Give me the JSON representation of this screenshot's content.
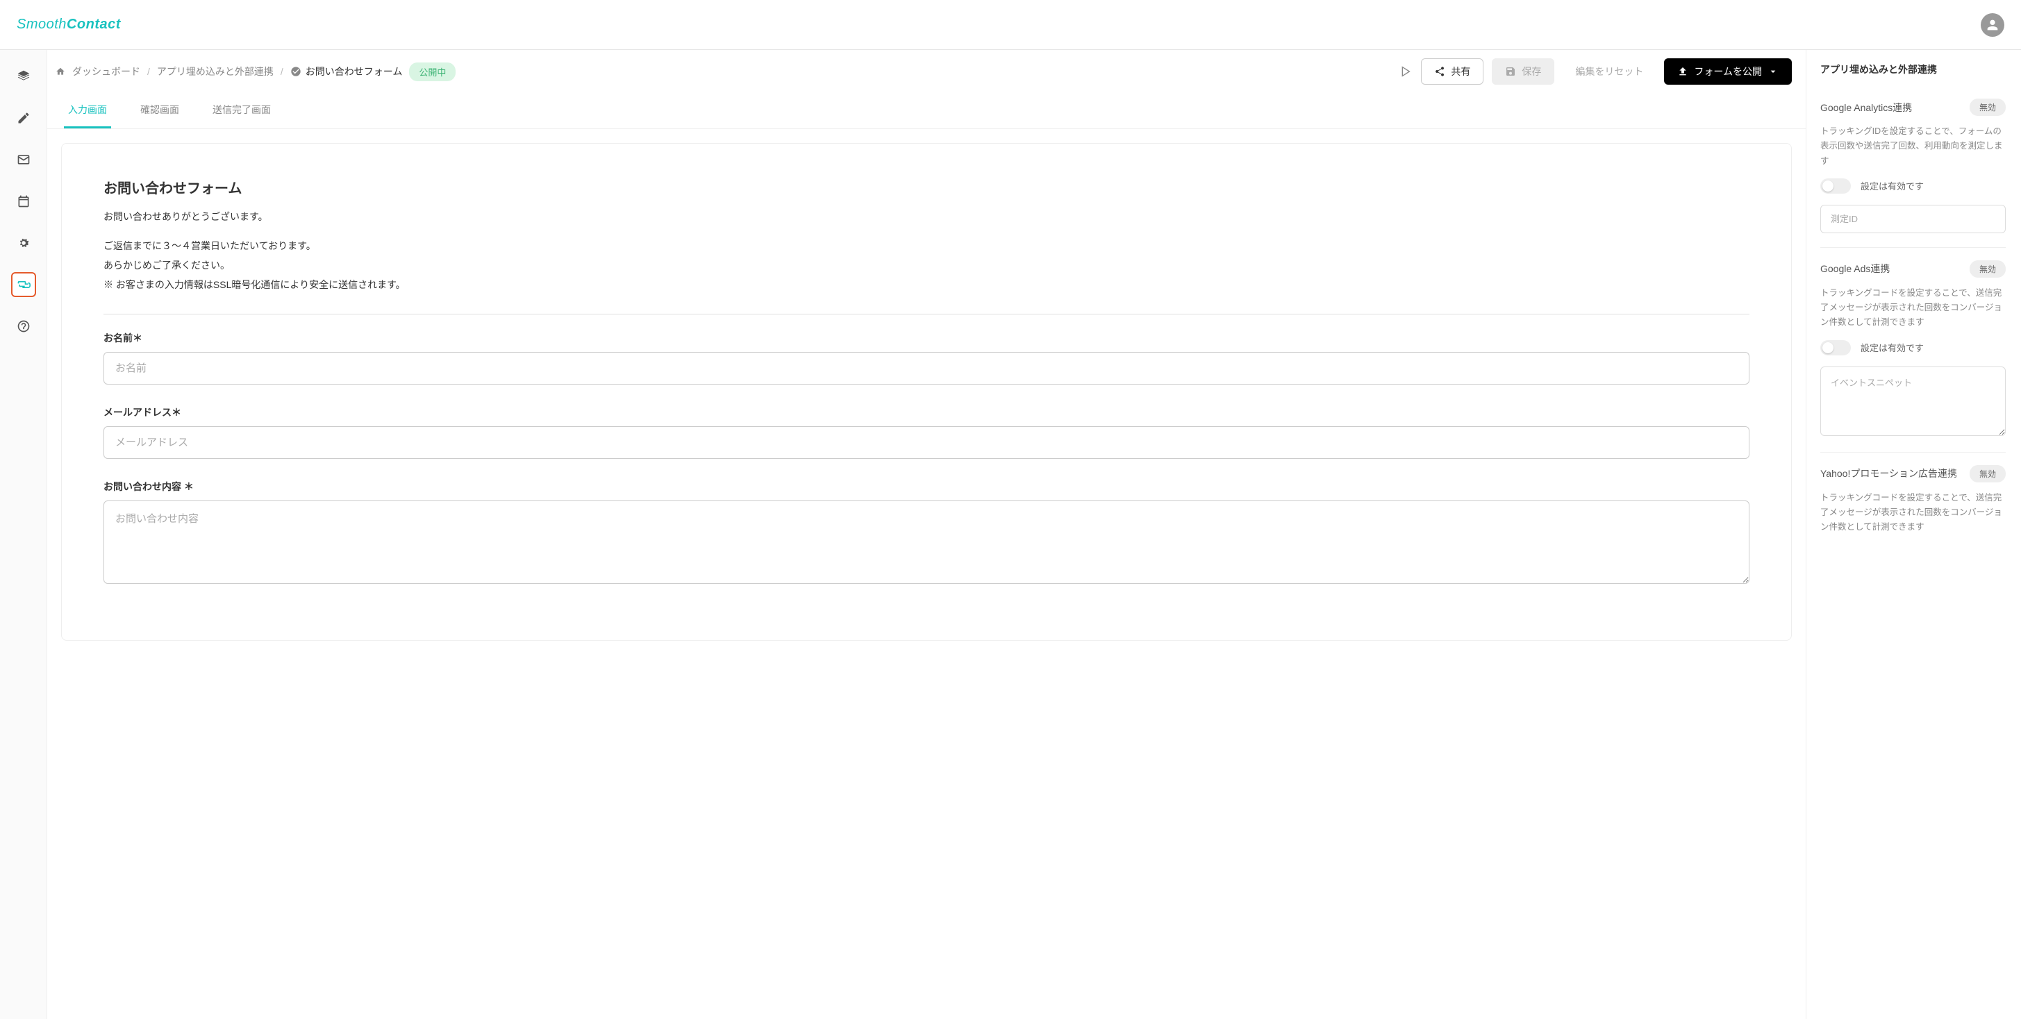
{
  "logo": {
    "part1": "Smooth",
    "part2": "Contact"
  },
  "breadcrumbs": {
    "dashboard": "ダッシュボード",
    "embed": "アプリ埋め込みと外部連携",
    "form": "お問い合わせフォーム"
  },
  "status": "公開中",
  "toolbar": {
    "share": "共有",
    "save": "保存",
    "reset": "編集をリセット",
    "publish": "フォームを公開"
  },
  "tabs": {
    "input": "入力画面",
    "confirm": "確認画面",
    "done": "送信完了画面"
  },
  "form": {
    "title": "お問い合わせフォーム",
    "desc1": "お問い合わせありがとうございます。",
    "desc2": "ご返信までに３〜４営業日いただいております。",
    "desc3": "あらかじめご了承ください。",
    "desc4": "※ お客さまの入力情報はSSL暗号化通信により安全に送信されます。",
    "name_label": "お名前＊",
    "name_placeholder": "お名前",
    "email_label": "メールアドレス＊",
    "email_placeholder": "メールアドレス",
    "inquiry_label": "お問い合わせ内容 ＊",
    "inquiry_placeholder": "お問い合わせ内容"
  },
  "rightPanel": {
    "title": "アプリ埋め込みと外部連携",
    "sections": [
      {
        "title": "Google Analytics連携",
        "badge": "無効",
        "desc": "トラッキングIDを設定することで、フォームの表示回数や送信完了回数、利用動向を測定します",
        "toggleLabel": "設定は有効です",
        "inputPlaceholder": "測定ID"
      },
      {
        "title": "Google Ads連携",
        "badge": "無効",
        "desc": "トラッキングコードを設定することで、送信完了メッセージが表示された回数をコンバージョン件数として計測できます",
        "toggleLabel": "設定は有効です",
        "textareaPlaceholder": "イベントスニペット"
      },
      {
        "title": "Yahoo!プロモーション広告連携",
        "badge": "無効",
        "desc": "トラッキングコードを設定することで、送信完了メッセージが表示された回数をコンバージョン件数として計測できます"
      }
    ]
  }
}
